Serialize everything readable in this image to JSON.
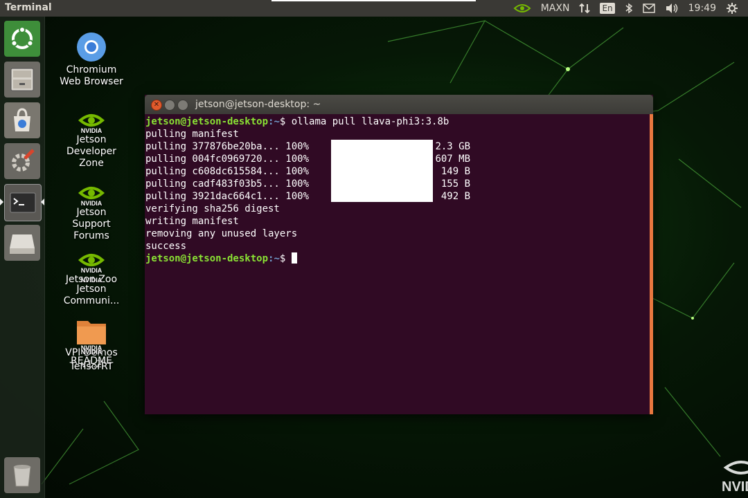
{
  "top_panel": {
    "app_title": "Terminal",
    "tray": {
      "power_mode": "MAXN",
      "keyboard_lang": "En",
      "clock": "19:49"
    }
  },
  "launcher": {
    "items": [
      {
        "name": "Ubuntu Dash",
        "icon": "ubuntu-logo-icon"
      },
      {
        "name": "Files",
        "icon": "file-cabinet-icon"
      },
      {
        "name": "Ubuntu Software",
        "icon": "shopping-bag-icon"
      },
      {
        "name": "System Settings",
        "icon": "settings-wrench-icon"
      },
      {
        "name": "Terminal",
        "icon": "terminal-icon",
        "active": true
      },
      {
        "name": "Removable Drive",
        "icon": "drive-icon"
      },
      {
        "name": "Trash",
        "icon": "trash-icon"
      }
    ]
  },
  "desktop": {
    "icons": [
      {
        "label": "Chromium Web Browser",
        "icon": "chromium-icon"
      },
      {
        "label": "Jetson Developer Zone",
        "icon": "nvidia-icon",
        "brand": "NVIDIA"
      },
      {
        "label": "Jetson Support Forums",
        "icon": "nvidia-icon",
        "brand": "NVIDIA"
      },
      {
        "label": "Jetson Zoo",
        "icon": "nvidia-icon",
        "brand": "NVIDIA"
      },
      {
        "label": "Jetson Communi...",
        "icon": "nvidia-icon",
        "brand": "NVIDIA"
      },
      {
        "label": "VPI Demos v1.2",
        "icon": "folder-icon"
      },
      {
        "label": "README",
        "icon": "nvidia-icon",
        "brand": "NVIDIA"
      },
      {
        "label": "TensorRT",
        "icon": "nvidia-icon",
        "brand": "NVIDIA"
      }
    ],
    "corner_logo": "NVID"
  },
  "terminal": {
    "title": "jetson@jetson-desktop: ~",
    "prompt_user": "jetson@jetson-desktop",
    "prompt_path": ":~",
    "prompt_symbol": "$",
    "command": "ollama pull llava-phi3:3.8b",
    "lines": [
      {
        "text": "pulling manifest"
      },
      {
        "text": "pulling 377876be20ba... 100%",
        "size": "2.3 GB"
      },
      {
        "text": "pulling 004fc0969720... 100%",
        "size": "607 MB"
      },
      {
        "text": "pulling c608dc615584... 100%",
        "size": "149 B"
      },
      {
        "text": "pulling cadf483f03b5... 100%",
        "size": "155 B"
      },
      {
        "text": "pulling 3921dac664c1... 100%",
        "size": "492 B"
      },
      {
        "text": "verifying sha256 digest"
      },
      {
        "text": "writing manifest"
      },
      {
        "text": "removing any unused layers"
      },
      {
        "text": "success"
      }
    ]
  },
  "colors": {
    "terminal_bg": "#300a24",
    "prompt_user": "#8ae234",
    "prompt_path": "#729fcf",
    "close_button": "#e05a2b",
    "scrollbar": "#e9773f"
  }
}
